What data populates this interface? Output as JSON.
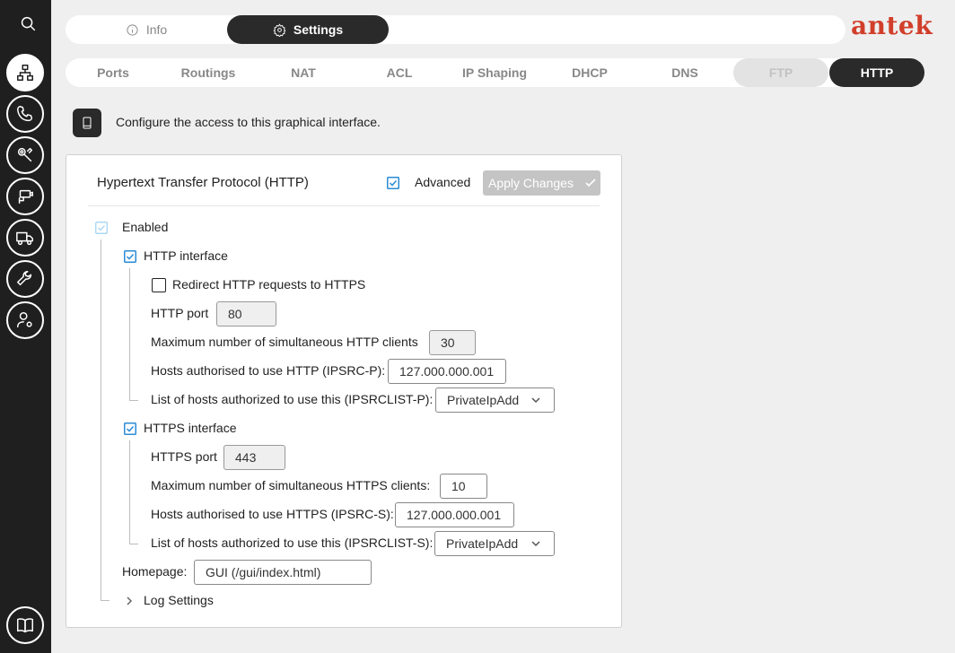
{
  "sidebar": {
    "items": [
      {
        "icon": "search-icon"
      },
      {
        "icon": "network-icon"
      },
      {
        "icon": "phone-icon"
      },
      {
        "icon": "tools-icon"
      },
      {
        "icon": "camera-icon"
      },
      {
        "icon": "truck-icon"
      },
      {
        "icon": "wrench-icon"
      },
      {
        "icon": "user-settings-icon"
      },
      {
        "icon": "book-icon"
      }
    ]
  },
  "topbar": {
    "info_label": "Info",
    "settings_label": "Settings"
  },
  "logo": "antek",
  "subtabs": [
    "Ports",
    "Routings",
    "NAT",
    "ACL",
    "IP Shaping",
    "DHCP",
    "DNS",
    "FTP",
    "HTTP"
  ],
  "description": "Configure the access to this graphical interface.",
  "panel": {
    "title": "Hypertext Transfer Protocol (HTTP)",
    "advanced_label": "Advanced",
    "apply_label": "Apply Changes",
    "enabled_label": "Enabled",
    "http": {
      "interface_label": "HTTP interface",
      "redirect_label": "Redirect HTTP requests to HTTPS",
      "port_label": "HTTP port",
      "port_value": "80",
      "max_clients_label": "Maximum number of simultaneous HTTP clients",
      "max_clients_value": "30",
      "hosts_label": "Hosts authorised to use HTTP (IPSRC-P):",
      "hosts_value": "127.000.000.001",
      "list_label": "List of hosts authorized to use this (IPSRCLIST-P):",
      "list_value": "PrivateIpAdd"
    },
    "https": {
      "interface_label": "HTTPS interface",
      "port_label": "HTTPS port",
      "port_value": "443",
      "max_clients_label": "Maximum number of simultaneous HTTPS clients:",
      "max_clients_value": "10",
      "hosts_label": "Hosts authorised to use HTTPS (IPSRC-S):",
      "hosts_value": "127.000.000.001",
      "list_label": "List of hosts authorized to use this (IPSRCLIST-S):",
      "list_value": "PrivateIpAdd"
    },
    "homepage_label": "Homepage:",
    "homepage_value": "GUI (/gui/index.html)",
    "log_settings_label": "Log Settings"
  },
  "colors": {
    "accent": "#d13f2b",
    "check": "#2a8bd6",
    "dark": "#2a2a2a"
  }
}
